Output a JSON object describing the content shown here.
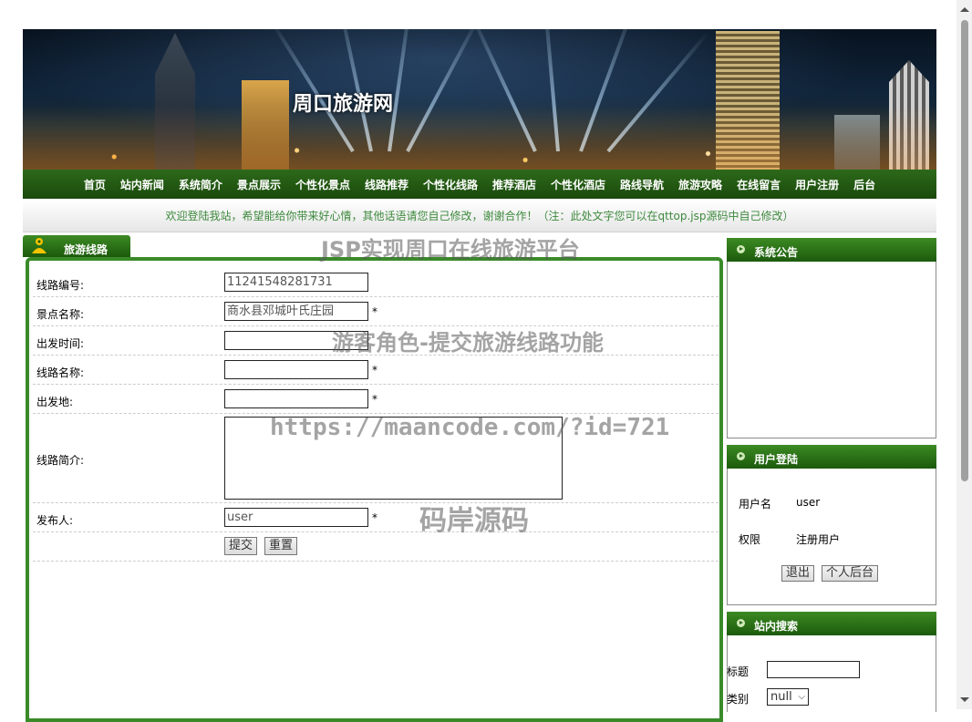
{
  "site": {
    "title": "周口旅游网"
  },
  "nav": [
    "首页",
    "站内新闻",
    "系统简介",
    "景点展示",
    "个性化景点",
    "线路推荐",
    "个性化线路",
    "推荐酒店",
    "个性化酒店",
    "路线导航",
    "旅游攻略",
    "在线留言",
    "用户注册",
    "后台"
  ],
  "welcome": "欢迎登陆我站，希望能给你带来好心情，其他话语请您自己修改，谢谢合作！（注：此处文字您可以在qttop.jsp源码中自己修改）",
  "main": {
    "tab_label": "旅游线路",
    "fields": {
      "route_no": {
        "label": "线路编号:",
        "value": "11241548281731"
      },
      "spot_name": {
        "label": "景点名称:",
        "value": "商水县邓城叶氏庄园",
        "required": "*"
      },
      "depart_time": {
        "label": "出发时间:",
        "value": ""
      },
      "route_name": {
        "label": "线路名称:",
        "value": "",
        "required": "*"
      },
      "depart_place": {
        "label": "出发地:",
        "value": "",
        "required": "*"
      },
      "route_intro": {
        "label": "线路简介:",
        "value": ""
      },
      "publisher": {
        "label": "发布人:",
        "value": "user",
        "required": "*"
      }
    },
    "buttons": {
      "submit": "提交",
      "reset": "重置"
    }
  },
  "sidebar": {
    "announcement": {
      "title": "系统公告"
    },
    "login": {
      "title": "用户登陆",
      "username_label": "用户名",
      "username_value": "user",
      "role_label": "权限",
      "role_value": "注册用户",
      "logout": "退出",
      "personal": "个人后台"
    },
    "search": {
      "title": "站内搜索",
      "title_label": "标题",
      "category_label": "类别",
      "category_selected": "null"
    }
  },
  "watermarks": {
    "w1": "JSP实现周口在线旅游平台",
    "w2": "游客角色-提交旅游线路功能",
    "w3": "https://maancode.com/?id=721",
    "w4": "码岸源码"
  },
  "colors": {
    "nav_green": "#1a4a0c",
    "accent_green": "#3a8a2a",
    "welcome_text": "#3e8a3e"
  }
}
